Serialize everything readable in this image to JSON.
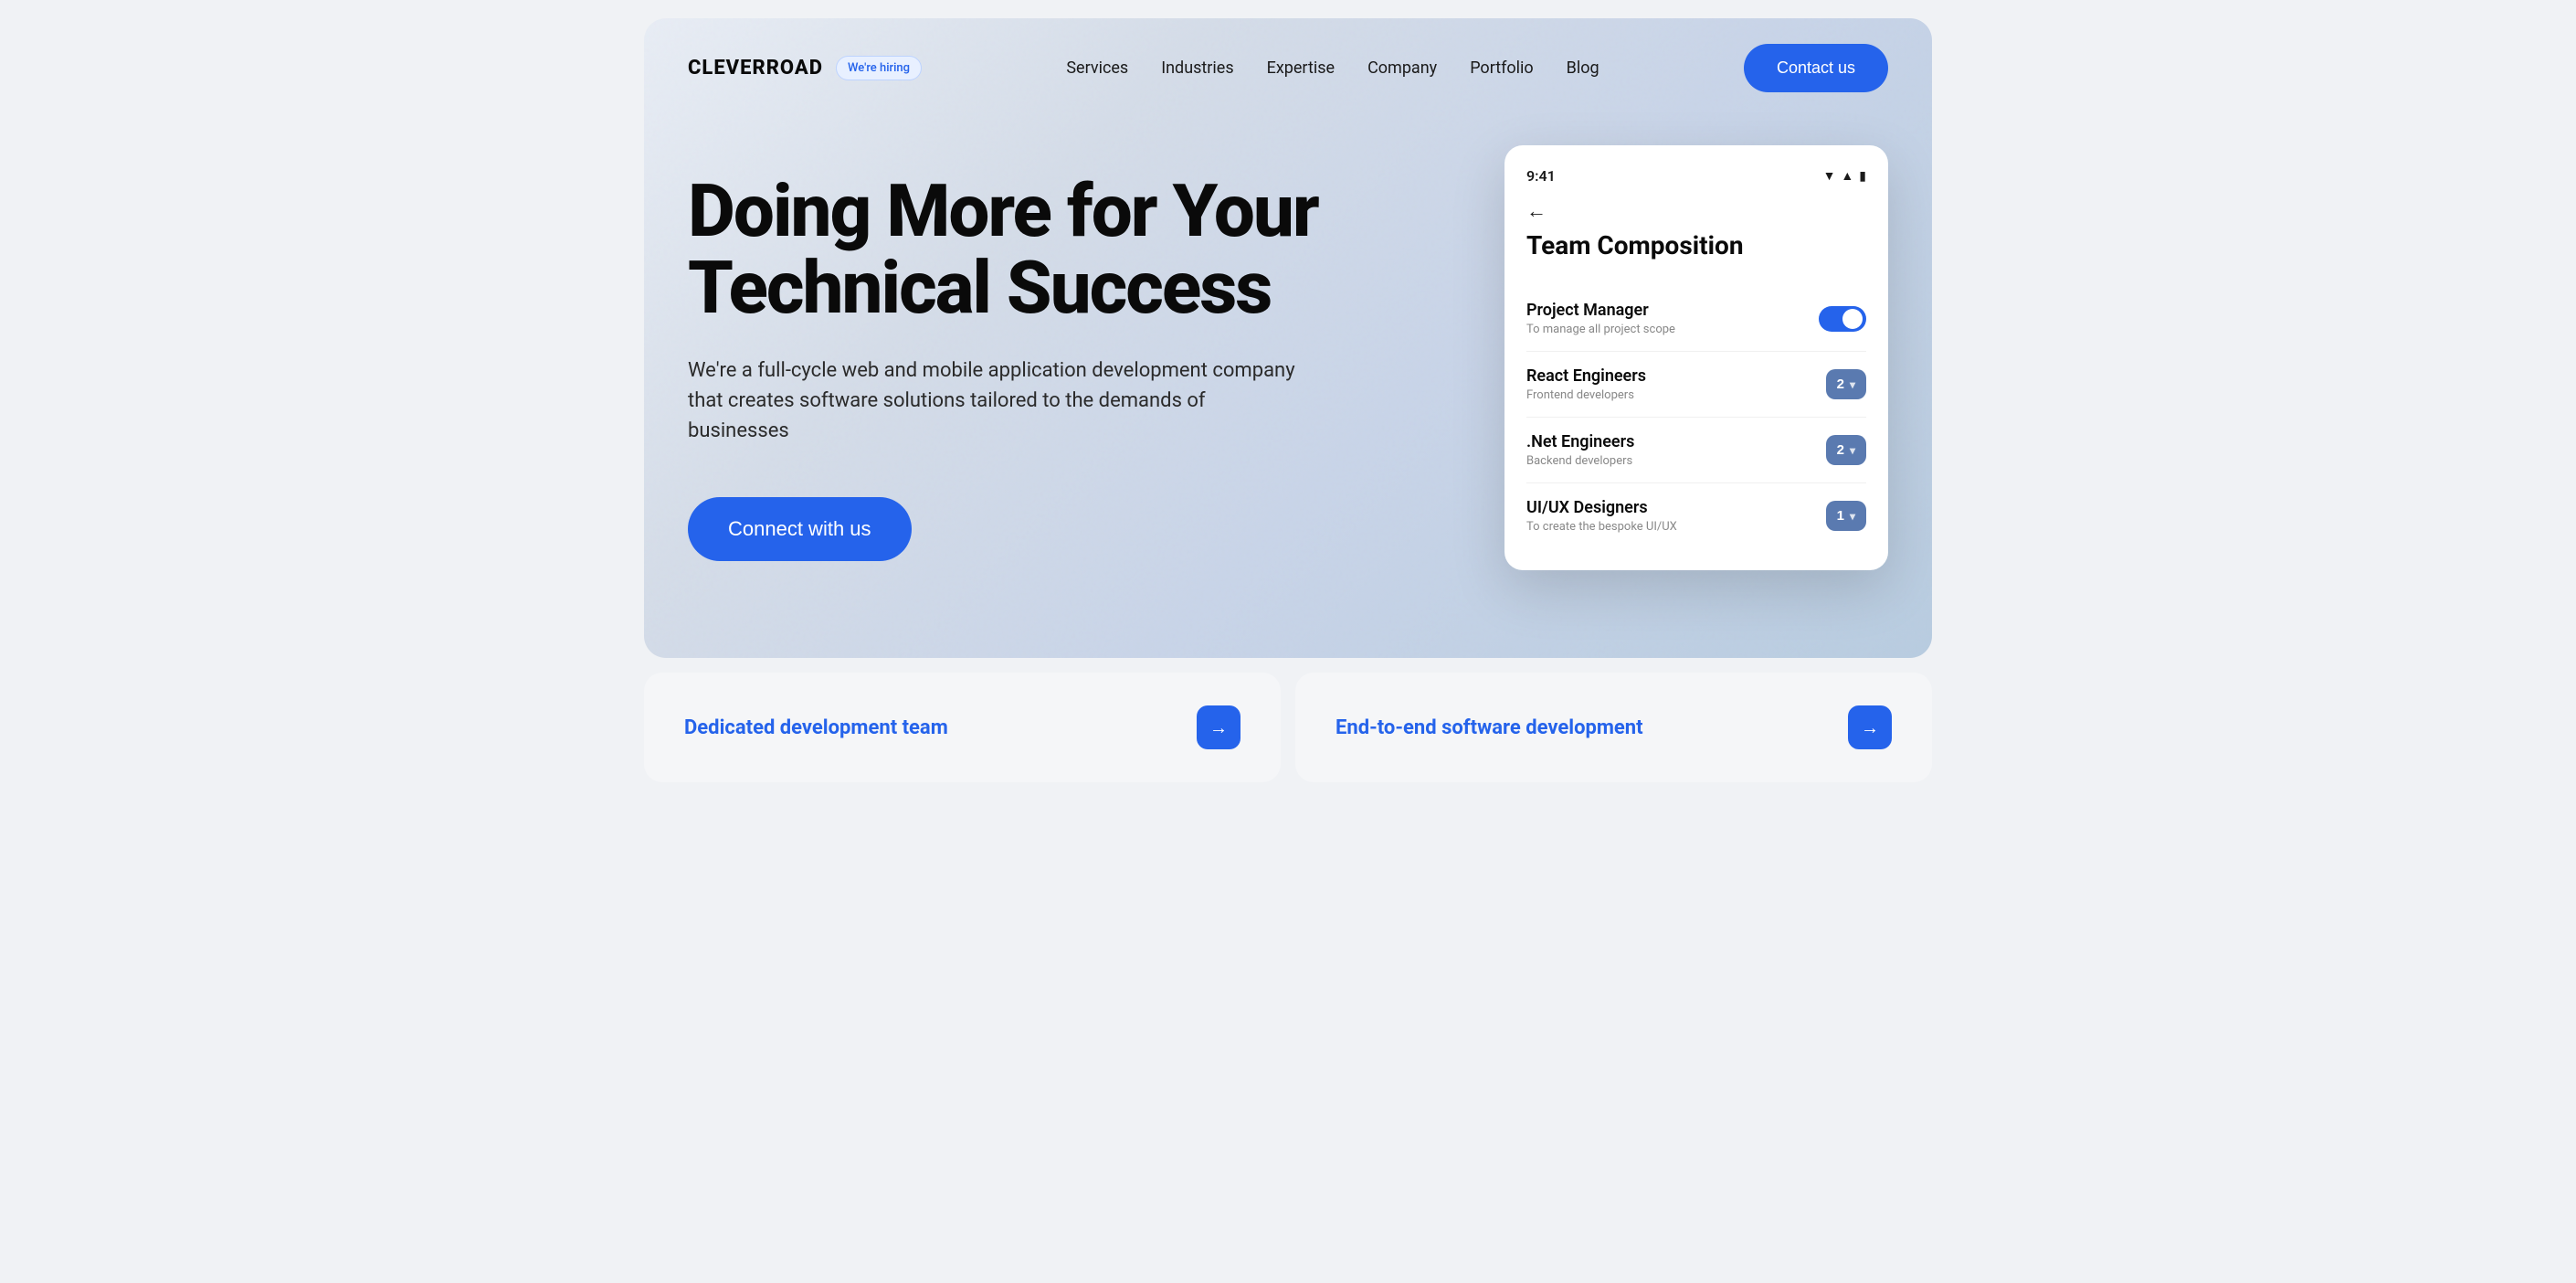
{
  "brand": {
    "logo": "CLEVERROAD",
    "hiring_badge": "We're hiring"
  },
  "nav": {
    "links": [
      {
        "label": "Services",
        "href": "#"
      },
      {
        "label": "Industries",
        "href": "#"
      },
      {
        "label": "Expertise",
        "href": "#"
      },
      {
        "label": "Company",
        "href": "#"
      },
      {
        "label": "Portfolio",
        "href": "#"
      },
      {
        "label": "Blog",
        "href": "#"
      }
    ],
    "contact_button": "Contact us"
  },
  "hero": {
    "title": "Doing More for Your Technical Success",
    "subtitle": "We're a full-cycle web and mobile application development company that creates software solutions tailored to the demands of businesses",
    "cta_button": "Connect with us"
  },
  "phone_mockup": {
    "time": "9:41",
    "heading": "Team Composition",
    "back_arrow": "←",
    "team_items": [
      {
        "name": "Project Manager",
        "description": "To manage all project scope",
        "control_type": "toggle",
        "value": true
      },
      {
        "name": "React Engineers",
        "description": "Frontend developers",
        "control_type": "counter",
        "value": 2
      },
      {
        "name": ".Net Engineers",
        "description": "Backend developers",
        "control_type": "counter",
        "value": 2
      },
      {
        "name": "UI/UX Designers",
        "description": "To create the bespoke UI/UX",
        "control_type": "counter",
        "value": 1
      }
    ]
  },
  "bottom_cards": [
    {
      "label": "Dedicated development team",
      "arrow": "→"
    },
    {
      "label": "End-to-end software development",
      "arrow": "→"
    }
  ],
  "colors": {
    "accent_blue": "#2563eb",
    "counter_blue": "#5a7ab0",
    "text_dark": "#0a0a0a",
    "text_sub": "#2a2a2a",
    "badge_bg": "#e8f0ff",
    "badge_color": "#2563eb"
  }
}
